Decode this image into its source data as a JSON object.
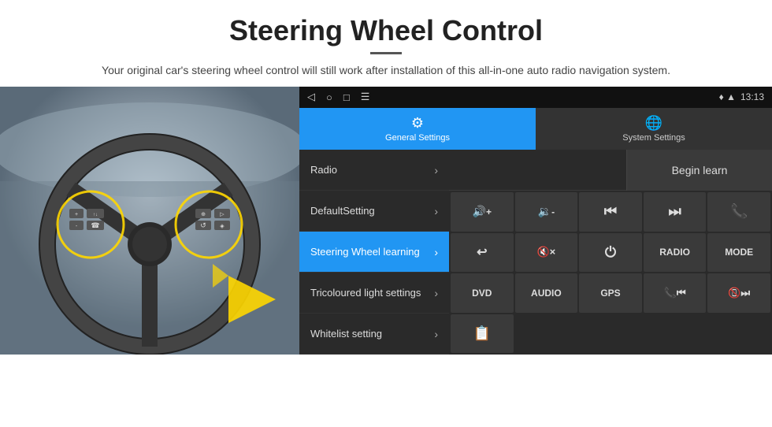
{
  "header": {
    "title": "Steering Wheel Control",
    "divider": true,
    "subtitle": "Your original car's steering wheel control will still work after installation of this all-in-one auto radio navigation system."
  },
  "status_bar": {
    "icons": [
      "◁",
      "○",
      "□",
      "☰"
    ],
    "right_icons": "♦ ▲",
    "time": "13:13"
  },
  "tabs": [
    {
      "id": "general",
      "label": "General Settings",
      "icon": "⚙",
      "active": true
    },
    {
      "id": "system",
      "label": "System Settings",
      "icon": "🌐",
      "active": false
    }
  ],
  "menu": [
    {
      "id": "radio",
      "label": "Radio",
      "active": false
    },
    {
      "id": "default",
      "label": "DefaultSetting",
      "active": false
    },
    {
      "id": "steering",
      "label": "Steering Wheel learning",
      "active": true
    },
    {
      "id": "tricoloured",
      "label": "Tricoloured light settings",
      "active": false
    },
    {
      "id": "whitelist",
      "label": "Whitelist setting",
      "active": false
    }
  ],
  "right_panel": {
    "begin_learn_label": "Begin learn",
    "buttons": [
      {
        "id": "vol-up",
        "icon": "🔊+",
        "label": "VOL+"
      },
      {
        "id": "vol-down",
        "icon": "🔉-",
        "label": "VOL-"
      },
      {
        "id": "prev-track",
        "icon": "⏮",
        "label": "|◄◄"
      },
      {
        "id": "next-track",
        "icon": "⏭",
        "label": "►►|"
      },
      {
        "id": "phone",
        "icon": "📞",
        "label": "☎"
      },
      {
        "id": "hang-up",
        "icon": "📵",
        "label": "↩"
      },
      {
        "id": "mute",
        "icon": "🔇",
        "label": "🔇×"
      },
      {
        "id": "power",
        "icon": "⏻",
        "label": "⏻"
      },
      {
        "id": "radio-btn",
        "label": "RADIO"
      },
      {
        "id": "mode-btn",
        "label": "MODE"
      },
      {
        "id": "dvd-btn",
        "label": "DVD"
      },
      {
        "id": "audio-btn",
        "label": "AUDIO"
      },
      {
        "id": "gps-btn",
        "label": "GPS"
      },
      {
        "id": "prev-combined",
        "label": "📞⏮"
      },
      {
        "id": "next-combined",
        "label": "📵⏭"
      },
      {
        "id": "extra",
        "label": "📋"
      }
    ]
  }
}
